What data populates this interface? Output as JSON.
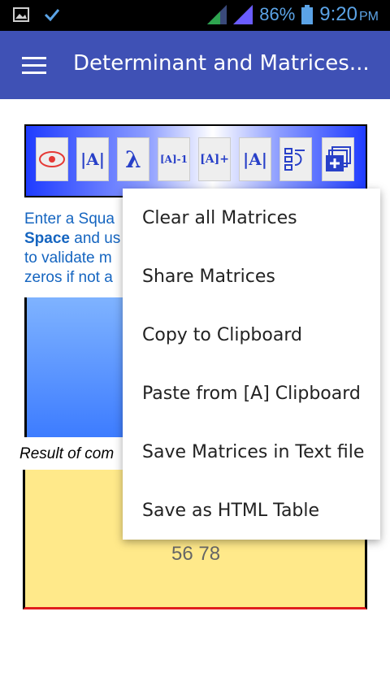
{
  "statusbar": {
    "battery_pct": "86%",
    "time": "9:20",
    "ampm": "PM",
    "icons": [
      "image-icon",
      "check-icon",
      "signal-icon",
      "signal-icon-2",
      "battery-icon"
    ]
  },
  "appbar": {
    "title": "Determinant and Matrices..."
  },
  "toolbar": {
    "items": [
      "eye-icon",
      "det-A-icon",
      "lambda-icon",
      "inverse-A-icon",
      "pseudo-inverse-A-icon",
      "abs-A-icon",
      "steps-icon",
      "add-matrix-icon"
    ],
    "labels": {
      "det": "|A|",
      "inverse": "[A]-1",
      "pseudo": "[A]+",
      "abs": "|A|"
    }
  },
  "instruction": {
    "line1": "Enter a Squa",
    "line2_bold": "Space",
    "line2_rest": " and us",
    "line3": "to validate m",
    "line4": "zeros if not a"
  },
  "result": {
    "label": "Result of com",
    "row": "56  78"
  },
  "menu": {
    "items": [
      "Clear all Matrices",
      "Share Matrices",
      "Copy to Clipboard",
      "Paste from [A] Clipboard",
      "Save Matrices in Text file",
      "Save as HTML Table"
    ]
  }
}
